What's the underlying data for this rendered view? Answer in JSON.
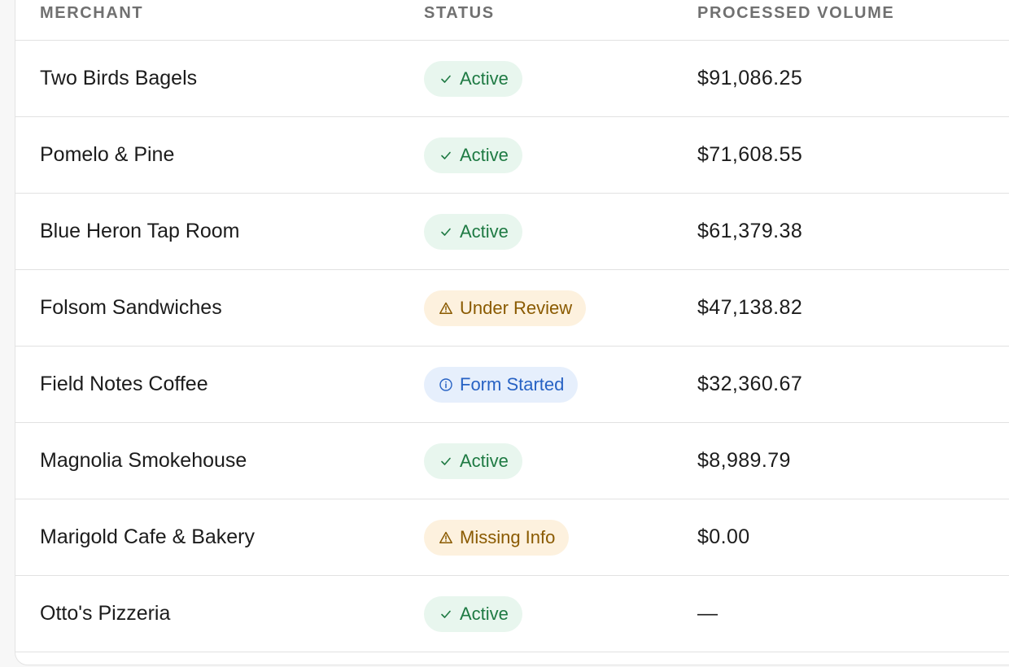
{
  "table": {
    "headers": {
      "merchant": "MERCHANT",
      "status": "STATUS",
      "volume": "PROCESSED VOLUME"
    },
    "rows": [
      {
        "merchant": "Two Birds Bagels",
        "status": "Active",
        "status_kind": "success",
        "status_icon": "check-icon",
        "volume": "$91,086.25"
      },
      {
        "merchant": "Pomelo & Pine",
        "status": "Active",
        "status_kind": "success",
        "status_icon": "check-icon",
        "volume": "$71,608.55"
      },
      {
        "merchant": "Blue Heron Tap Room",
        "status": "Active",
        "status_kind": "success",
        "status_icon": "check-icon",
        "volume": "$61,379.38"
      },
      {
        "merchant": "Folsom Sandwiches",
        "status": "Under Review",
        "status_kind": "warning",
        "status_icon": "warning-triangle-icon",
        "volume": "$47,138.82"
      },
      {
        "merchant": "Field Notes Coffee",
        "status": "Form Started",
        "status_kind": "info",
        "status_icon": "info-circle-icon",
        "volume": "$32,360.67"
      },
      {
        "merchant": "Magnolia Smokehouse",
        "status": "Active",
        "status_kind": "success",
        "status_icon": "check-icon",
        "volume": "$8,989.79"
      },
      {
        "merchant": "Marigold Cafe & Bakery",
        "status": "Missing Info",
        "status_kind": "warning",
        "status_icon": "warning-triangle-icon",
        "volume": "$0.00"
      },
      {
        "merchant": "Otto's Pizzeria",
        "status": "Active",
        "status_kind": "success",
        "status_icon": "check-icon",
        "volume": "—"
      }
    ]
  },
  "colors": {
    "success_bg": "#e8f6ee",
    "success_text": "#1e7a43",
    "warning_bg": "#fdf1de",
    "warning_text": "#8a5a00",
    "info_bg": "#e6effc",
    "info_text": "#2762c4"
  }
}
